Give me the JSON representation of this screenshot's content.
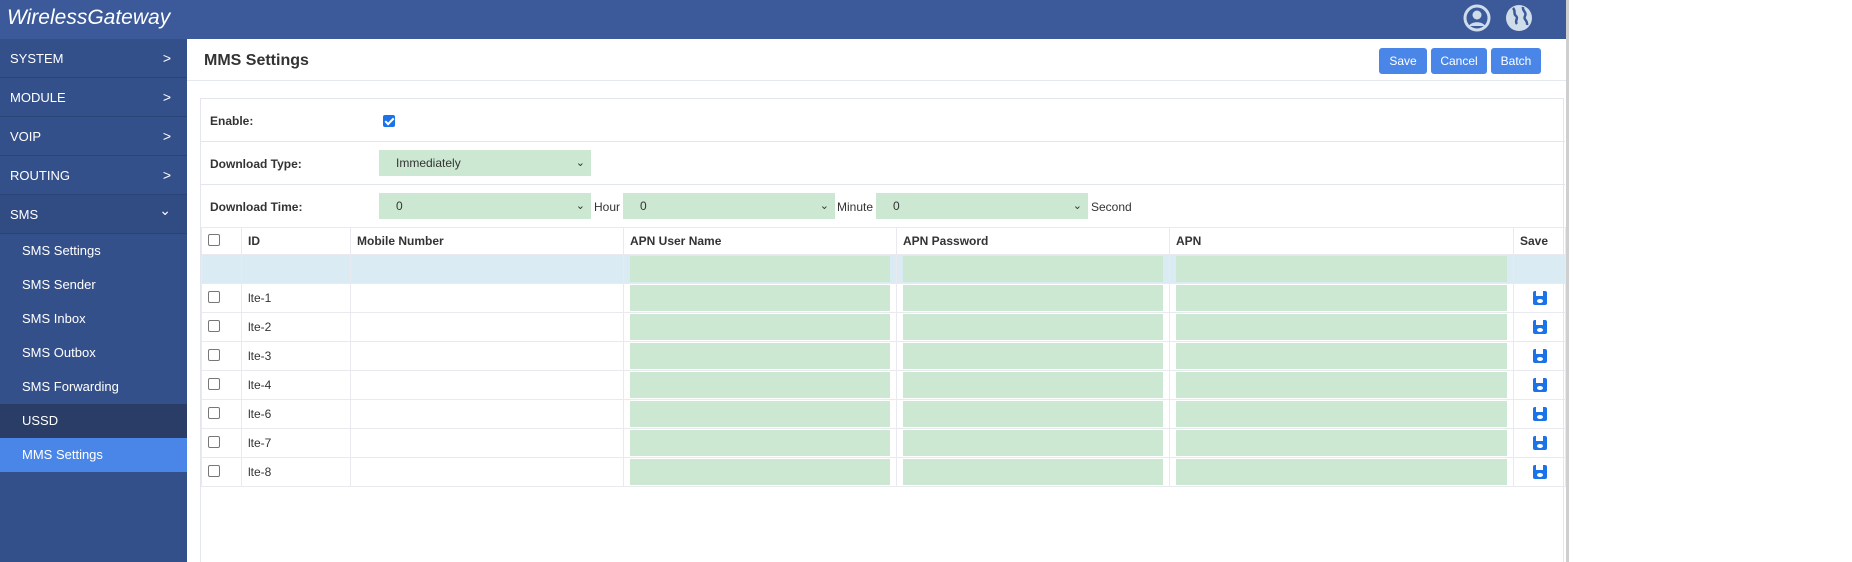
{
  "app": {
    "title": "WirelessGateway",
    "icons": [
      "user-icon",
      "globe-icon"
    ]
  },
  "colors": {
    "header": "#3c5a99",
    "sidebar": "#34508a",
    "active": "#4a86e8",
    "button": "#4a86e8",
    "input_bg": "#cde8d2"
  },
  "sidebar": {
    "items": [
      {
        "label": "SYSTEM",
        "chevron": ">"
      },
      {
        "label": "MODULE",
        "chevron": ">"
      },
      {
        "label": "VOIP",
        "chevron": ">"
      },
      {
        "label": "ROUTING",
        "chevron": ">"
      },
      {
        "label": "SMS",
        "chevron": "⌄"
      }
    ],
    "sub_items": [
      "SMS Settings",
      "SMS Sender",
      "SMS Inbox",
      "SMS Outbox",
      "SMS Forwarding",
      "USSD",
      "MMS Settings"
    ],
    "active": "MMS Settings"
  },
  "page": {
    "title": "MMS Settings",
    "buttons": {
      "save": "Save",
      "cancel": "Cancel",
      "batch": "Batch"
    }
  },
  "form": {
    "enable": {
      "label": "Enable:",
      "checked": true
    },
    "download_type": {
      "label": "Download Type:",
      "value": "Immediately"
    },
    "download_time": {
      "label": "Download Time:",
      "hour": "0",
      "hour_unit": "Hour",
      "minute": "0",
      "minute_unit": "Minute",
      "second": "0",
      "second_unit": "Second"
    }
  },
  "table": {
    "headers": [
      "ID",
      "Mobile Number",
      "APN User Name",
      "APN Password",
      "APN",
      "Save"
    ],
    "rows": [
      {
        "id": "lte-1"
      },
      {
        "id": "lte-2"
      },
      {
        "id": "lte-3"
      },
      {
        "id": "lte-4"
      },
      {
        "id": "lte-6"
      },
      {
        "id": "lte-7"
      },
      {
        "id": "lte-8"
      }
    ]
  }
}
